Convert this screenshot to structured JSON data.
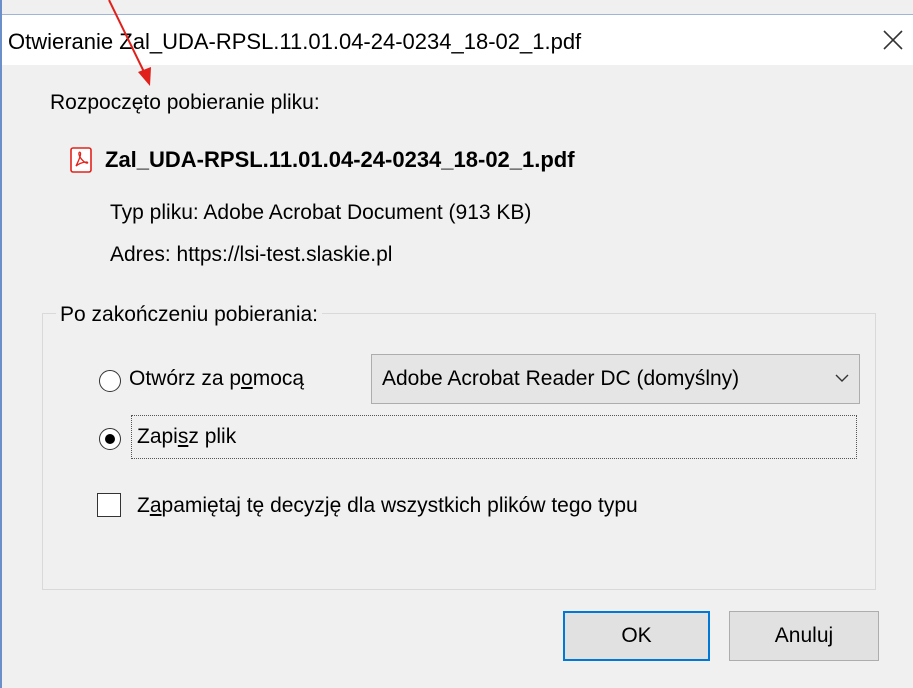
{
  "window": {
    "title": "Otwieranie Zal_UDA-RPSL.11.01.04-24-0234_18-02_1.pdf",
    "close_icon": "close-icon"
  },
  "intro": "Rozpoczęto pobieranie pliku:",
  "file": {
    "icon": "pdf-icon",
    "name": "Zal_UDA-RPSL.11.01.04-24-0234_18-02_1.pdf",
    "type_line": "Typ pliku: Adobe Acrobat Document (913 KB)",
    "address_line": "Adres: https://lsi-test.slaskie.pl"
  },
  "after_download": {
    "label": "Po zakończeniu pobierania:",
    "open_with": {
      "label_before": "Otwórz za p",
      "label_mnemonic": "o",
      "label_after": "mocą",
      "selected": false,
      "app": "Adobe Acrobat Reader DC  (domyślny)"
    },
    "save_file": {
      "label_before": "Zapi",
      "label_mnemonic": "s",
      "label_after": "z plik",
      "selected": true
    },
    "remember": {
      "label_before": "Z",
      "label_mnemonic": "a",
      "label_after": "pamiętaj tę decyzję dla wszystkich plików tego typu",
      "checked": false
    }
  },
  "buttons": {
    "ok": "OK",
    "cancel": "Anuluj"
  },
  "colors": {
    "accent": "#0078d7",
    "annotation_arrow": "#e0201b",
    "pdf_red": "#e2231a"
  }
}
